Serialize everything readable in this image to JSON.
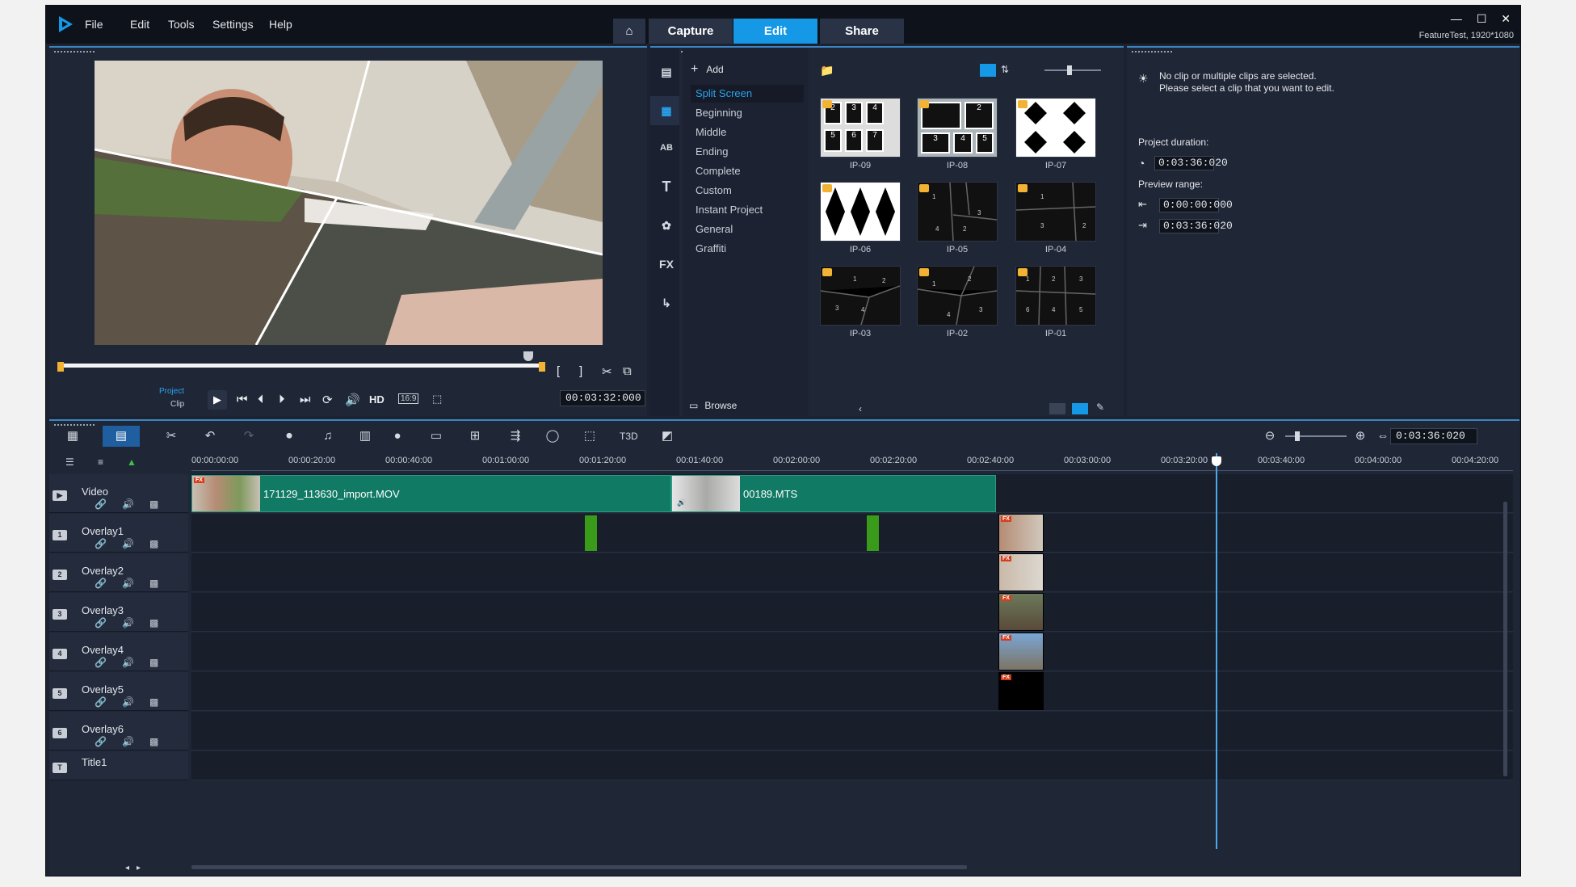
{
  "window": {
    "menu": [
      "File",
      "Edit",
      "Tools",
      "Settings",
      "Help"
    ],
    "tabs": [
      "Capture",
      "Edit",
      "Share"
    ],
    "active_tab": "Edit",
    "controls": [
      "—",
      "☐",
      "✕"
    ],
    "resolution": "FeatureTest, 1920*1080"
  },
  "player": {
    "project_label": "Project",
    "clip_label": "Clip",
    "hd_label": "HD",
    "aspect_label": "16:9",
    "timecode": "00:03:32:000",
    "play_icon": "play-icon",
    "trim_in_label": "[",
    "trim_out_label": "]"
  },
  "library": {
    "add_label": "Add",
    "browse_label": "Browse",
    "categories": [
      "Split Screen",
      "Beginning",
      "Middle",
      "Ending",
      "Complete",
      "Custom",
      "Instant Project",
      "General",
      "Graffiti"
    ],
    "active_category": "Split Screen",
    "templates": [
      "IP-09",
      "IP-08",
      "IP-07",
      "IP-06",
      "IP-05",
      "IP-04",
      "IP-03",
      "IP-02",
      "IP-01"
    ],
    "rail_icons": [
      "media-icon",
      "instant-project-icon",
      "title-icon",
      "text-icon",
      "graphics-icon",
      "fx-icon",
      "path-icon"
    ]
  },
  "options": {
    "message_line1": "No clip or multiple clips are selected.",
    "message_line2": "Please select a clip that you want to edit.",
    "project_duration_label": "Project duration:",
    "project_duration": "0:03:36:020",
    "preview_range_label": "Preview range:",
    "range_start": "0:00:00:000",
    "range_end": "0:03:36:020"
  },
  "timeline": {
    "timecode": "0:03:36:020",
    "ruler": [
      "00:00:00:00",
      "00:00:20:00",
      "00:00:40:00",
      "00:01:00:00",
      "00:01:20:00",
      "00:01:40:00",
      "00:02:00:00",
      "00:02:20:00",
      "00:02:40:00",
      "00:03:00:00",
      "00:03:20:00",
      "00:03:40:00",
      "00:04:00:00",
      "00:04:20:00"
    ],
    "tracks": [
      {
        "name": "Video",
        "icon_label": "▶"
      },
      {
        "name": "Overlay1",
        "icon_label": "1"
      },
      {
        "name": "Overlay2",
        "icon_label": "2"
      },
      {
        "name": "Overlay3",
        "icon_label": "3"
      },
      {
        "name": "Overlay4",
        "icon_label": "4"
      },
      {
        "name": "Overlay5",
        "icon_label": "5"
      },
      {
        "name": "Overlay6",
        "icon_label": "6"
      },
      {
        "name": "Title1",
        "icon_label": "T"
      }
    ],
    "clips": [
      {
        "name": "171129_113630_import.MOV"
      },
      {
        "name": "00189.MTS"
      }
    ],
    "fx_label": "FX"
  },
  "colors": {
    "accent": "#1598e6",
    "clip": "#117a64",
    "marker": "#3a9a1a",
    "trim": "#f2b233"
  }
}
